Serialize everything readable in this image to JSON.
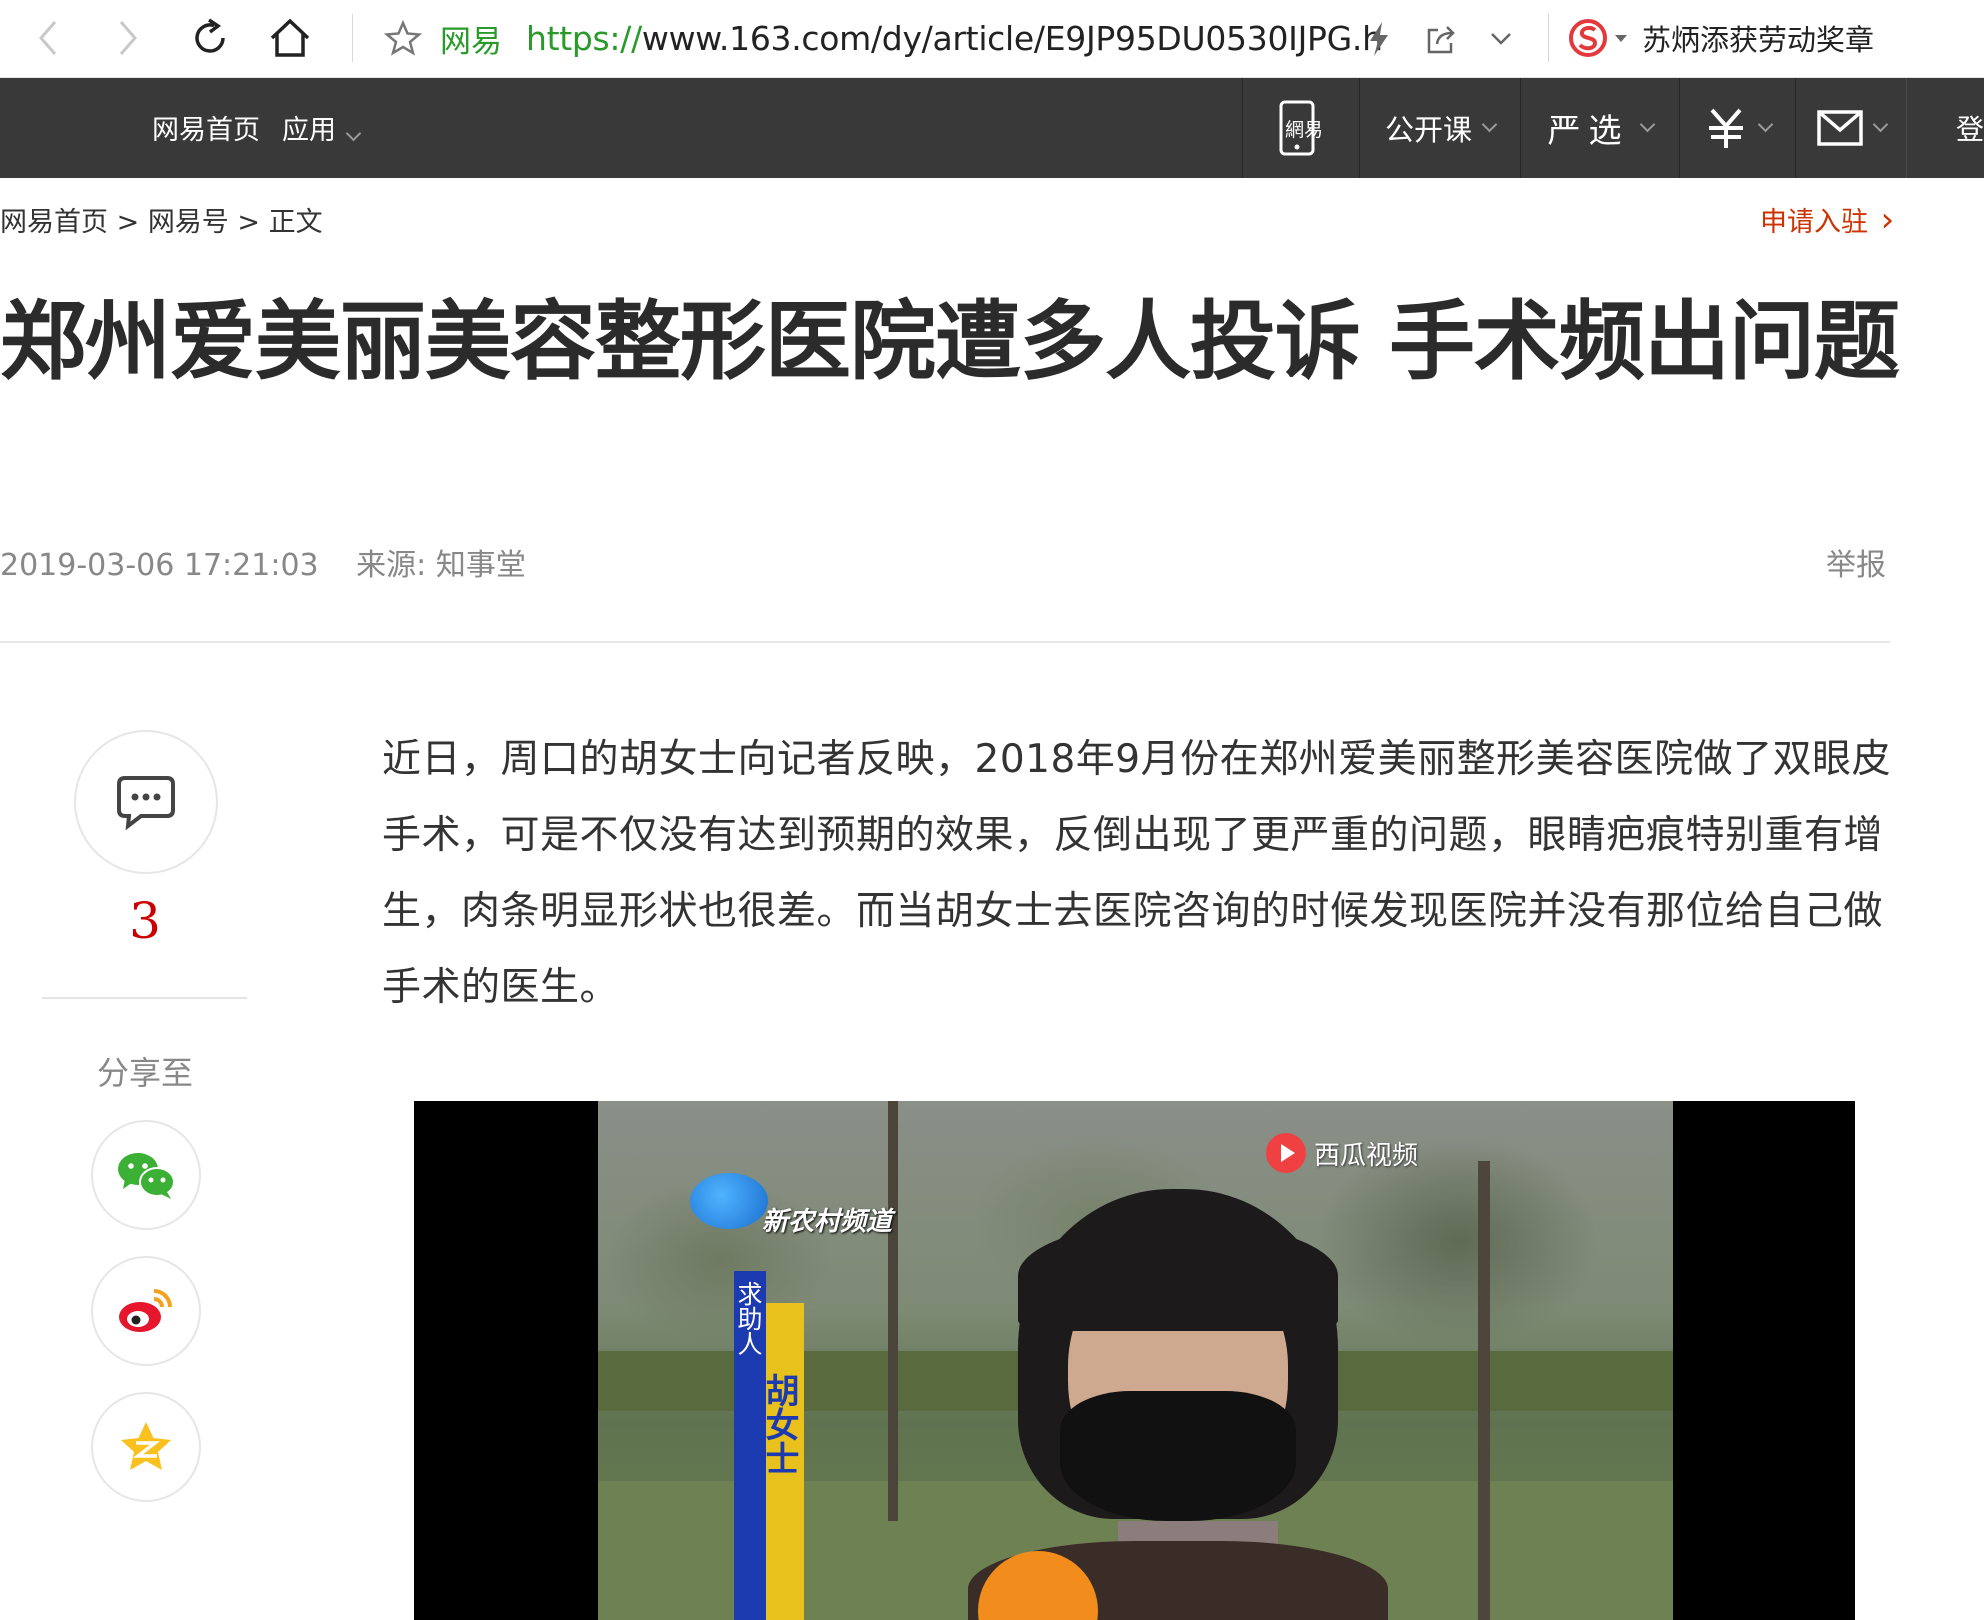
{
  "browser": {
    "site_name": "网易",
    "url_scheme": "https://",
    "url_rest": "www.163.com/dy/article/E9JP95DU0530IJPG.h",
    "search_hint": "苏炳添获劳动奖章"
  },
  "site_nav": {
    "home": "网易首页",
    "apps": "应用",
    "mobile_logo": "網易",
    "open_course": "公开课",
    "yanxuan": "严选",
    "login": "登"
  },
  "breadcrumb": {
    "home": "网易首页",
    "sep": ">",
    "section": "网易号",
    "current": "正文"
  },
  "apply": {
    "label": "申请入驻",
    "arrow": "›"
  },
  "article": {
    "title": "郑州爱美丽美容整形医院遭多人投诉 手术频出问题",
    "datetime": "2019-03-06 17:21:03",
    "source": "来源: 知事堂",
    "report": "举报",
    "paragraph": "近日，周口的胡女士向记者反映，2018年9月份在郑州爱美丽整形美容医院做了双眼皮手术，可是不仅没有达到预期的效果，反倒出现了更严重的问题，眼睛疤痕特别重有增生，肉条明显形状也很差。而当胡女士去医院咨询的时候发现医院并没有那位给自己做手术的医生。"
  },
  "side": {
    "comment_count": "3",
    "share_label": "分享至"
  },
  "video": {
    "channel": "新农村频道",
    "watermark": "西瓜视频",
    "caption_role": "求助人",
    "caption_name": "胡女士"
  },
  "colors": {
    "nav_bg": "#393939",
    "accent_red": "#cc3300",
    "url_green": "#2a9a2a"
  }
}
